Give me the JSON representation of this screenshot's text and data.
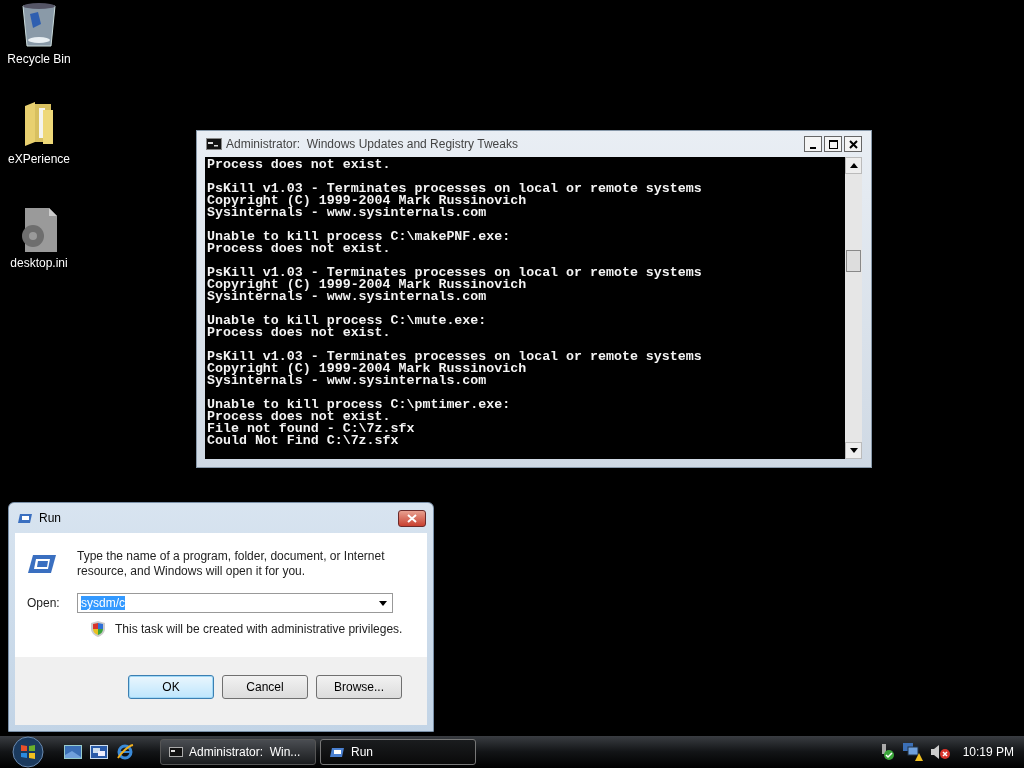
{
  "desktop_icons": [
    {
      "label": "Recycle Bin",
      "kind": "recycle"
    },
    {
      "label": "eXPerience",
      "kind": "folder"
    },
    {
      "label": "desktop.ini",
      "kind": "settings-file"
    }
  ],
  "console": {
    "title": "Administrator:  Windows Updates and Registry Tweaks",
    "blocks": [
      [
        "Process does not exist."
      ],
      [
        "PsKill v1.03 - Terminates processes on local or remote systems",
        "Copyright (C) 1999-2004 Mark Russinovich",
        "Sysinternals - www.sysinternals.com"
      ],
      [
        "Unable to kill process C:\\makePNF.exe:",
        "Process does not exist."
      ],
      [
        "PsKill v1.03 - Terminates processes on local or remote systems",
        "Copyright (C) 1999-2004 Mark Russinovich",
        "Sysinternals - www.sysinternals.com"
      ],
      [
        "Unable to kill process C:\\mute.exe:",
        "Process does not exist."
      ],
      [
        "PsKill v1.03 - Terminates processes on local or remote systems",
        "Copyright (C) 1999-2004 Mark Russinovich",
        "Sysinternals - www.sysinternals.com"
      ],
      [
        "Unable to kill process C:\\pmtimer.exe:",
        "Process does not exist.",
        "File not found - C:\\7z.sfx",
        "Could Not Find C:\\7z.sfx"
      ]
    ]
  },
  "run_dialog": {
    "title": "Run",
    "description": "Type the name of a program, folder, document, or Internet resource, and Windows will open it for you.",
    "open_label": "Open:",
    "open_value": "sysdm/c",
    "value_selected": true,
    "notice": "This task will be created with administrative privileges.",
    "buttons": [
      {
        "label": "OK",
        "default": true
      },
      {
        "label": "Cancel",
        "default": false
      },
      {
        "label": "Browse...",
        "default": false
      }
    ]
  },
  "taskbar": {
    "tasks": [
      {
        "label": "Administrator:  Win...",
        "kind": "console",
        "selected": false
      },
      {
        "label": "Run",
        "kind": "run",
        "selected": true
      }
    ],
    "clock": "10:19 PM"
  }
}
